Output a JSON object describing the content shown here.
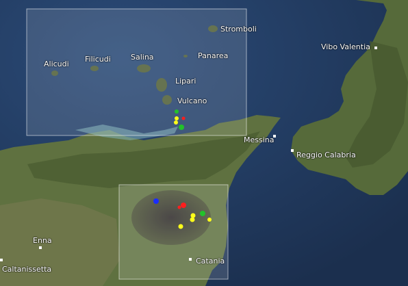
{
  "map": {
    "islands": [
      "Stromboli",
      "Alicudi",
      "Filicudi",
      "Salina",
      "Panarea",
      "Lipari",
      "Vulcano"
    ],
    "cities": [
      "Vibo Valentia",
      "Messina",
      "Reggio Calabria",
      "Enna",
      "Caltanissetta",
      "Catania"
    ]
  },
  "colors": {
    "sea": "#22385a",
    "land": "#5f6f40",
    "highlight_box": "rgba(255,255,255,0.12)",
    "marker_red": "#ff1e1e",
    "marker_yellow": "#ffff1a",
    "marker_green": "#22c22a",
    "marker_blue": "#1a2cff"
  },
  "markers": {
    "aeolian": [
      "green",
      "yellow",
      "red",
      "yellow",
      "green"
    ],
    "etna": [
      "blue",
      "red",
      "red",
      "green",
      "yellow",
      "yellow",
      "yellow",
      "yellow"
    ]
  }
}
